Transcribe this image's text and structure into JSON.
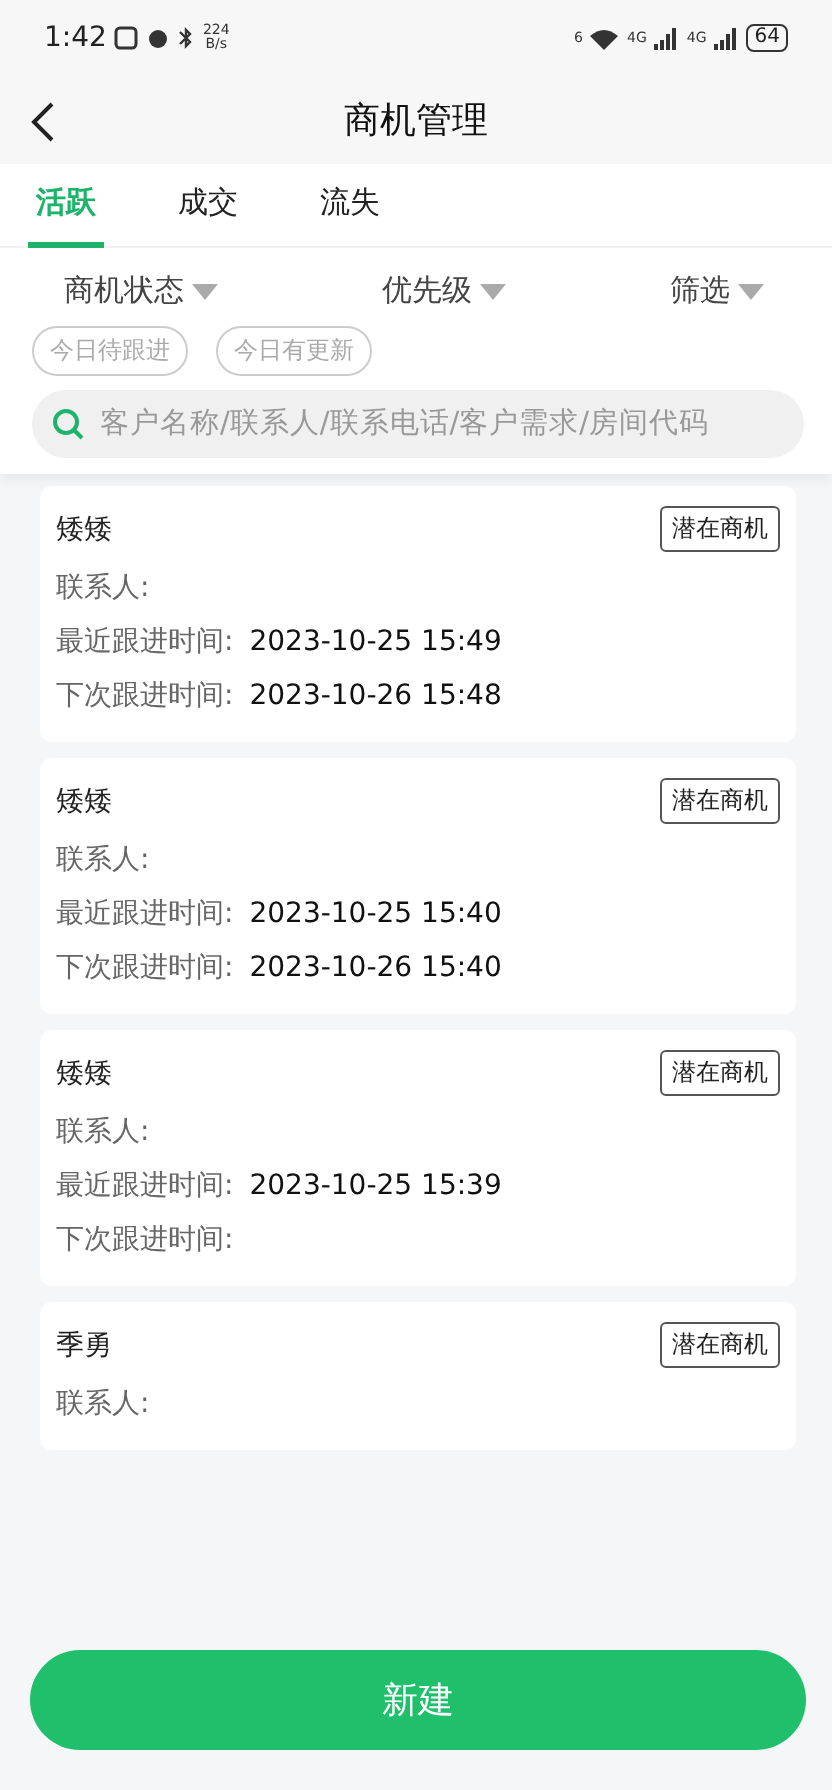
{
  "status_bar": {
    "time": "1:42",
    "speed_value": "224",
    "speed_unit": "B/s",
    "wifi_label": "6",
    "signals": [
      "4G",
      "4G"
    ],
    "battery": "64"
  },
  "header": {
    "title": "商机管理"
  },
  "tabs": [
    {
      "label": "活跃",
      "selected": true
    },
    {
      "label": "成交",
      "selected": false
    },
    {
      "label": "流失",
      "selected": false
    }
  ],
  "filters": [
    "商机状态",
    "优先级",
    "筛选"
  ],
  "quick_tags": [
    {
      "label": "今日待跟进",
      "selected": false
    },
    {
      "label": "今日有更新",
      "selected": false
    }
  ],
  "search": {
    "placeholder": "客户名称/联系人/联系电话/客户需求/房间代码"
  },
  "cards": [
    {
      "name": "矮矮",
      "tag": "潜在商机",
      "fields": [
        {
          "label": "联系人:"
        },
        {
          "label": "最近跟进时间:",
          "value": "2023-10-25 15:49"
        },
        {
          "label": "下次跟进时间:",
          "value": "2023-10-26 15:48"
        }
      ]
    },
    {
      "name": "矮矮",
      "tag": "潜在商机",
      "fields": [
        {
          "label": "联系人:"
        },
        {
          "label": "最近跟进时间:",
          "value": "2023-10-25 15:40"
        },
        {
          "label": "下次跟进时间:",
          "value": "2023-10-26 15:40"
        }
      ]
    },
    {
      "name": "矮矮",
      "tag": "潜在商机",
      "fields": [
        {
          "label": "联系人:"
        },
        {
          "label": "最近跟进时间:",
          "value": "2023-10-25 15:39"
        },
        {
          "label": "下次跟进时间:"
        }
      ]
    },
    {
      "name": "季勇",
      "tag": "潜在商机",
      "fields": [
        {
          "label": "联系人:"
        }
      ]
    }
  ],
  "create_button": {
    "label": "新建"
  }
}
